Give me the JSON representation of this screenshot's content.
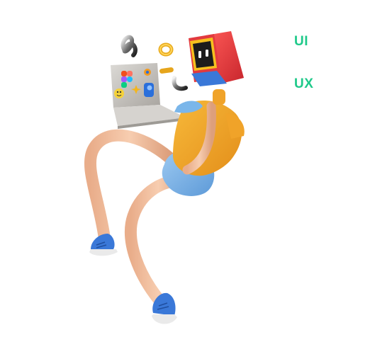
{
  "labels": {
    "first": "UI",
    "second": "UX"
  },
  "colors": {
    "accent": "#1fc98a",
    "skin": "#f2c4a4",
    "shirt": "#f3a828",
    "shorts": "#7ab6ea",
    "shoes": "#3a78d8",
    "monitor": "#e8353a",
    "laptop": "#c9c6c2"
  },
  "illustration": {
    "icons": [
      "squiggle-icon",
      "ring-icon",
      "tube-icon",
      "hook-icon",
      "smiley-icon",
      "app-logo-icon"
    ]
  }
}
